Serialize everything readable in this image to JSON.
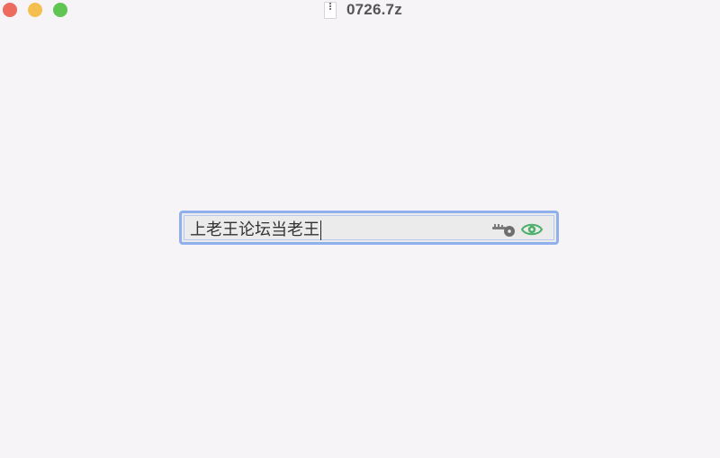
{
  "window": {
    "title": "0726.7z",
    "controls": {
      "close": "close",
      "minimize": "minimize",
      "zoom": "zoom"
    }
  },
  "password_field": {
    "value": "上老王论坛当老王",
    "icons": [
      "key-icon",
      "eye-icon"
    ]
  },
  "colors": {
    "close": "#ec6a5e",
    "minimize": "#f4bf4f",
    "zoom": "#61c554",
    "focus_ring": "#8fb0ec",
    "eye": "#4caf6a",
    "key": "#7a7a7a"
  }
}
